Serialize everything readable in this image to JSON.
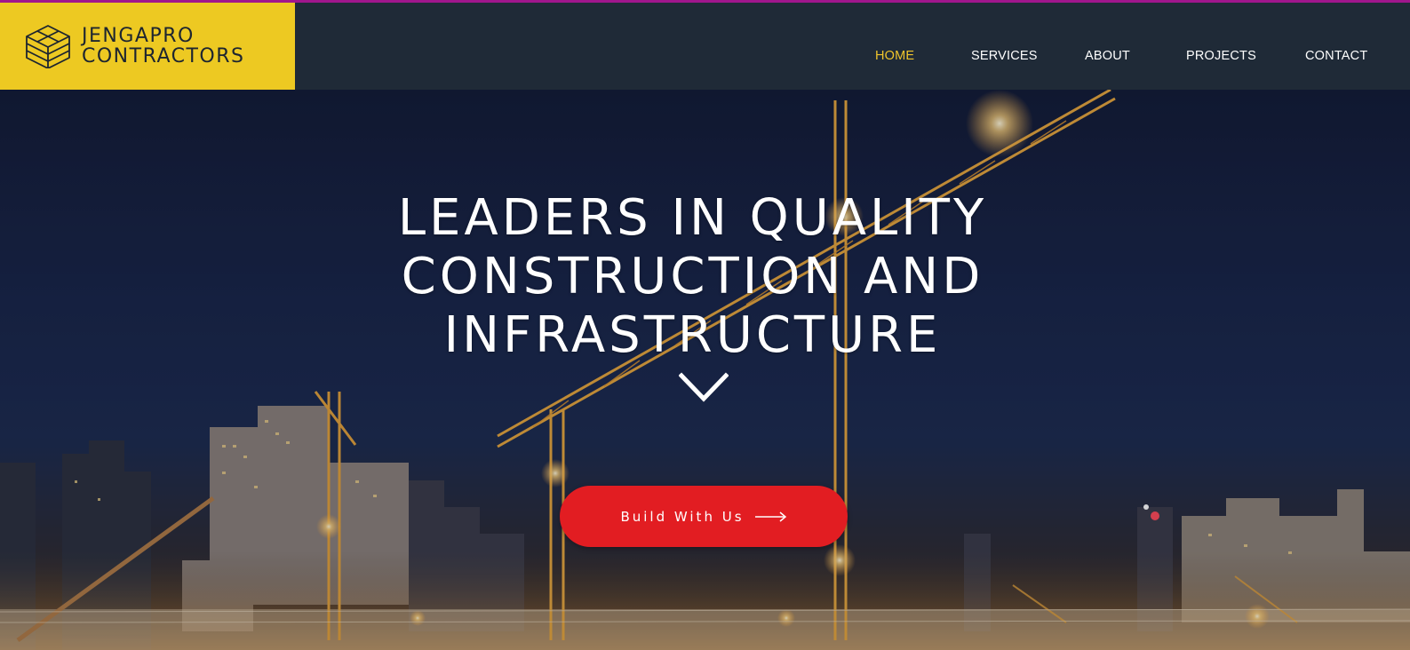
{
  "brand": {
    "line1": "JENGAPRO",
    "line2": "CONTRACTORS",
    "icon": "isometric-stack-logo-icon",
    "logo_bg": "#edc922"
  },
  "nav": {
    "items": [
      {
        "label": "HOME",
        "active": true
      },
      {
        "label": "SERVICES",
        "active": false
      },
      {
        "label": "ABOUT",
        "active": false
      },
      {
        "label": "PROJECTS",
        "active": false
      },
      {
        "label": "CONTACT",
        "active": false
      }
    ],
    "active_color": "#f0c52c"
  },
  "hero": {
    "headline_lines": [
      "LEADERS IN QUALITY",
      "CONSTRUCTION AND",
      "INFRASTRUCTURE"
    ],
    "scroll_icon": "chevron-down-icon",
    "cta_label": "Build With Us",
    "cta_icon": "arrow-right-icon",
    "cta_color": "#e21d22"
  },
  "colors": {
    "top_accent": "#a0168c",
    "header_bg": "#1f2a37"
  }
}
